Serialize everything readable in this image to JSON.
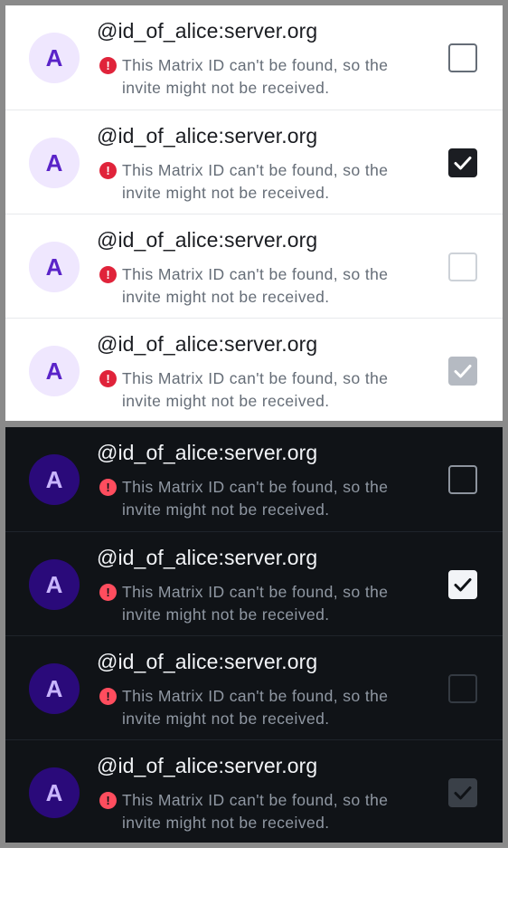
{
  "colors": {
    "frame": "#8a8a8a",
    "light_bg": "#ffffff",
    "dark_bg": "#101317",
    "error": "#e0233a",
    "avatar_light_bg": "#efe7fe",
    "avatar_light_fg": "#5a23c8",
    "avatar_dark_bg": "#2a0a7a",
    "avatar_dark_fg": "#c9b5ff"
  },
  "light_panel": {
    "rows": [
      {
        "avatar": "A",
        "user_id": "@id_of_alice:server.org",
        "warning": "This Matrix ID can't be found, so the invite might not be received.",
        "checkbox_state": "unchecked",
        "icon": "error-icon"
      },
      {
        "avatar": "A",
        "user_id": "@id_of_alice:server.org",
        "warning": "This Matrix ID can't be found, so the invite might not be received.",
        "checkbox_state": "checked",
        "icon": "error-icon"
      },
      {
        "avatar": "A",
        "user_id": "@id_of_alice:server.org",
        "warning": "This Matrix ID can't be found, so the invite might not be received.",
        "checkbox_state": "disabled-unchecked",
        "icon": "error-icon"
      },
      {
        "avatar": "A",
        "user_id": "@id_of_alice:server.org",
        "warning": "This Matrix ID can't be found, so the invite might not be received.",
        "checkbox_state": "disabled-checked",
        "icon": "error-icon"
      }
    ]
  },
  "dark_panel": {
    "rows": [
      {
        "avatar": "A",
        "user_id": "@id_of_alice:server.org",
        "warning": "This Matrix ID can't be found, so the invite might not be received.",
        "checkbox_state": "unchecked",
        "icon": "error-icon"
      },
      {
        "avatar": "A",
        "user_id": "@id_of_alice:server.org",
        "warning": "This Matrix ID can't be found, so the invite might not be received.",
        "checkbox_state": "checked",
        "icon": "error-icon"
      },
      {
        "avatar": "A",
        "user_id": "@id_of_alice:server.org",
        "warning": "This Matrix ID can't be found, so the invite might not be received.",
        "checkbox_state": "disabled-unchecked",
        "icon": "error-icon"
      },
      {
        "avatar": "A",
        "user_id": "@id_of_alice:server.org",
        "warning": "This Matrix ID can't be found, so the invite might not be received.",
        "checkbox_state": "disabled-checked",
        "icon": "error-icon"
      }
    ]
  }
}
